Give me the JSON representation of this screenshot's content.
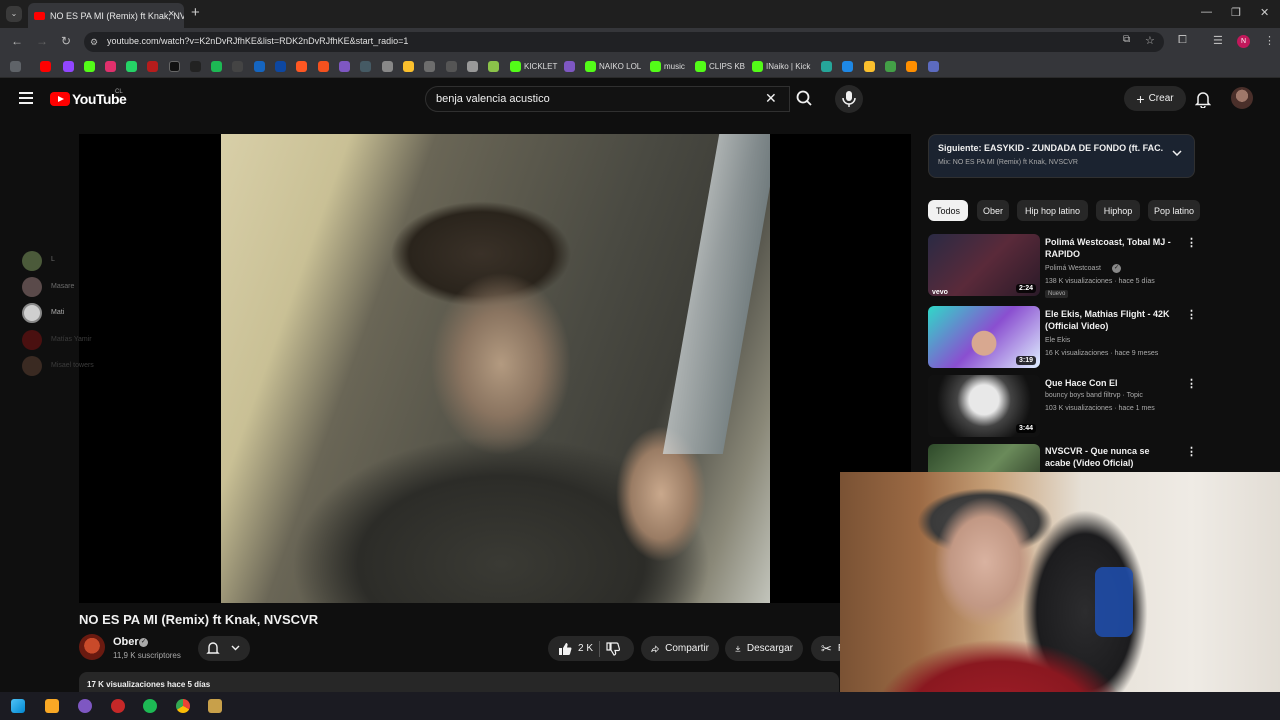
{
  "browser": {
    "tab_title": "NO ES PA MI (Remix) ft Knak, NVSCVR - YouTube",
    "tab_close": "×",
    "new_tab": "+",
    "url": "youtube.com/watch?v=K2nDvRJfhKE&list=RDK2nDvRJfhKE&start_radio=1",
    "window_controls": [
      "—",
      "❐",
      "✕"
    ],
    "bookmarks": [
      {
        "label": "KICKLET",
        "color": "#53fc18"
      },
      {
        "label": "NAIKO LOL",
        "color": "#1e88e5"
      },
      {
        "label": "music",
        "color": "#777777"
      },
      {
        "label": "CLIPS KB",
        "color": "#53fc18"
      },
      {
        "label": "INaiko | Kick",
        "color": "#53fc18"
      }
    ]
  },
  "youtube": {
    "logo_text": "YouTube",
    "country": "CL",
    "search_query": "benja valencia acustico",
    "search_clear": "✕",
    "create_label": "Crear",
    "create_icon": "+"
  },
  "video": {
    "title": "NO ES PA MI (Remix) ft Knak, NVSCVR",
    "channel": "Ober",
    "verified": "✓",
    "subscribers": "11,9 K suscriptores",
    "likes": "2 K",
    "share_label": "Compartir",
    "download_label": "Descargar",
    "clip_label": "R",
    "views_date": "17 K visualizaciones  hace 5 días"
  },
  "side_users": [
    {
      "name": "L"
    },
    {
      "name": "Masare"
    },
    {
      "name": "Mati"
    },
    {
      "name": "Matías Yamir"
    },
    {
      "name": "Misael towers"
    }
  ],
  "up_next": {
    "title": "Siguiente: EASYKID - ZUNDADA DE FONDO (ft. FAC...",
    "subtitle": "Mix: NO ES PA MI (Remix) ft Knak, NVSCVR"
  },
  "chips": [
    "Todos",
    "Ober",
    "Hip hop latino",
    "Hiphop",
    "Pop latino"
  ],
  "recommendations": [
    {
      "title": "Polimá Westcoast, Tobal MJ - RAPIDO",
      "channel": "Polimá Westcoast",
      "meta": "138 K visualizaciones · hace 5 días",
      "badge": "Nuevo",
      "duration": "2:24",
      "thumb": "linear-gradient(135deg,#2a2a44,#5a2a3a 50%,#2a1a28)"
    },
    {
      "title": "Ele Ekis, Mathias Flight - 42K (Official Video)",
      "channel": "Ele Ekis",
      "meta": "16 K visualizaciones · hace 9 meses",
      "duration": "3:19",
      "thumb": "radial-gradient(circle at 50% 60%,#d8a890 0 18%,transparent 19%),linear-gradient(135deg,#2fd9c8,#8a4fd0 50%,#e0f0ff)"
    },
    {
      "title": "Que Hace Con El",
      "channel": "bouncy boys band filtrvp · Topic",
      "meta": "103 K visualizaciones · hace 1 mes",
      "duration": "3:44",
      "thumb": "radial-gradient(circle at 50% 40%,#e8e8e8 0 22%,#444 40%,#111 70%)"
    },
    {
      "title": "NVSCVR - Que nunca se acabe (Video Oficial)",
      "channel": "",
      "meta": "",
      "duration": "",
      "thumb": "linear-gradient(135deg,#2e4a2a,#6a8a5a 50%,#1e2a1a)"
    }
  ]
}
